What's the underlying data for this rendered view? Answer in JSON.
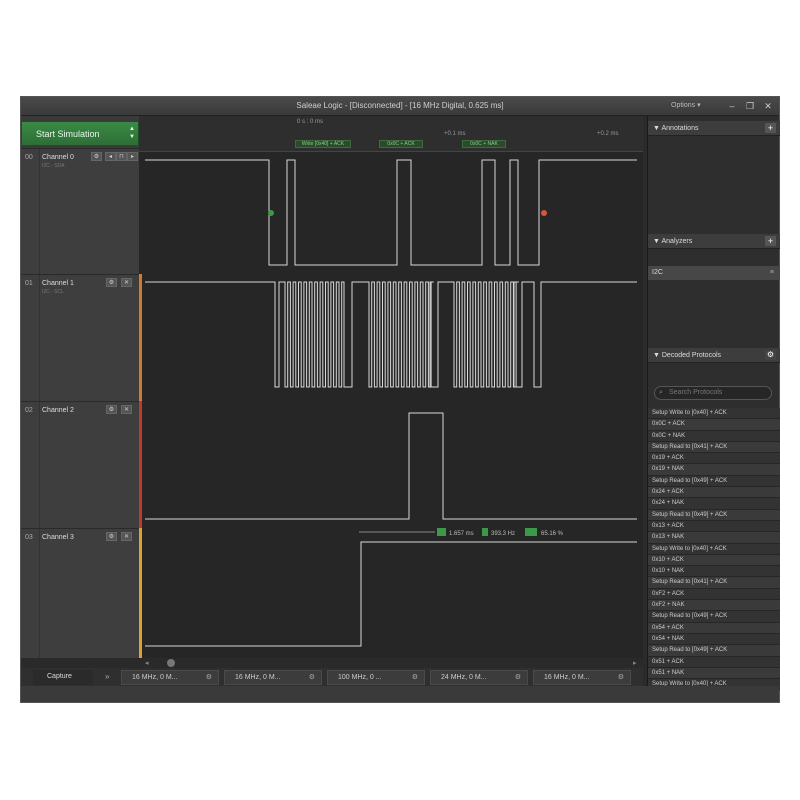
{
  "window": {
    "title": "Saleae Logic - [Disconnected] - [16 MHz Digital, 0.625 ms]",
    "options_label": "Options ▾",
    "minimize": "–",
    "restore": "❐",
    "close": "✕"
  },
  "controls": {
    "start_label": "Start Simulation"
  },
  "channels": [
    {
      "num": "00",
      "name": "Channel 0",
      "sub": "I2C - SDA"
    },
    {
      "num": "01",
      "name": "Channel 1",
      "sub": "I2C - SCL"
    },
    {
      "num": "02",
      "name": "Channel 2",
      "sub": ""
    },
    {
      "num": "03",
      "name": "Channel 3",
      "sub": ""
    }
  ],
  "ruler": {
    "t0": "0 s : 0 ms",
    "t1": "+0.1 ms",
    "t2": "+0.2 ms",
    "decodes": [
      "Write [0x40] + ACK",
      "0x0C + ACK",
      "0x0C + NAK"
    ]
  },
  "measure": {
    "width": "1.657 ms",
    "freq": "393.3 Hz",
    "duty": "65.16 %"
  },
  "tabs": {
    "capture": "Capture",
    "items": [
      "16 MHz, 0 M...",
      "16 MHz, 0 M...",
      "100 MHz, 0 ...",
      "24 MHz, 0 M...",
      "16 MHz, 0 M..."
    ]
  },
  "panels": {
    "annotations": "Annotations",
    "analyzers": "Analyzers",
    "analyzer_item": "I2C",
    "decoded": "Decoded Protocols",
    "search_placeholder": "Search Protocols"
  },
  "protocols": [
    "Setup Write to [0x40] + ACK",
    "0x0C + ACK",
    "0x0C + NAK",
    "Setup Read to [0x41] + ACK",
    "0x19 + ACK",
    "0x19 + NAK",
    "Setup Read to [0x49] + ACK",
    "0x24 + ACK",
    "0x24 + NAK",
    "Setup Read to [0x49] + ACK",
    "0x13 + ACK",
    "0x13 + NAK",
    "Setup Write to [0x40] + ACK",
    "0x10 + ACK",
    "0x10 + NAK",
    "Setup Read to [0x41] + ACK",
    "0xF2 + ACK",
    "0xF2 + NAK",
    "Setup Read to [0x49] + ACK",
    "0x54 + ACK",
    "0x54 + NAK",
    "Setup Read to [0x49] + ACK",
    "0x51 + ACK",
    "0x51 + NAK",
    "Setup Write to [0x40] + ACK"
  ]
}
